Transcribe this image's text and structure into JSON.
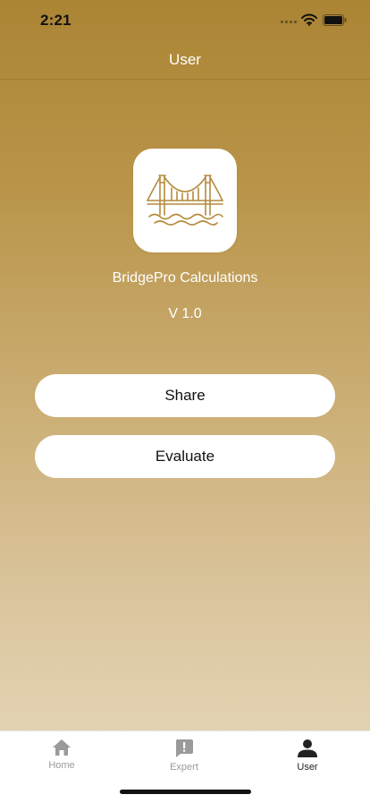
{
  "status_bar": {
    "time": "2:21",
    "icons": [
      "signal-dots-icon",
      "wifi-icon",
      "battery-icon"
    ]
  },
  "nav": {
    "title": "User"
  },
  "app": {
    "icon": "bridge-icon",
    "name": "BridgePro Calculations",
    "version": "V 1.0"
  },
  "actions": {
    "share_label": "Share",
    "evaluate_label": "Evaluate"
  },
  "tab_bar": {
    "items": [
      {
        "label": "Home",
        "icon": "home-icon",
        "active": false
      },
      {
        "label": "Expert",
        "icon": "expert-feedback-icon",
        "active": false
      },
      {
        "label": "User",
        "icon": "user-icon",
        "active": true
      }
    ]
  },
  "colors": {
    "gradient_top": "#ab8534",
    "gradient_bottom": "#e3d2b3",
    "icon_gold": "#b48a3c",
    "tab_active": "#222222",
    "tab_inactive": "#9a9a9a"
  }
}
